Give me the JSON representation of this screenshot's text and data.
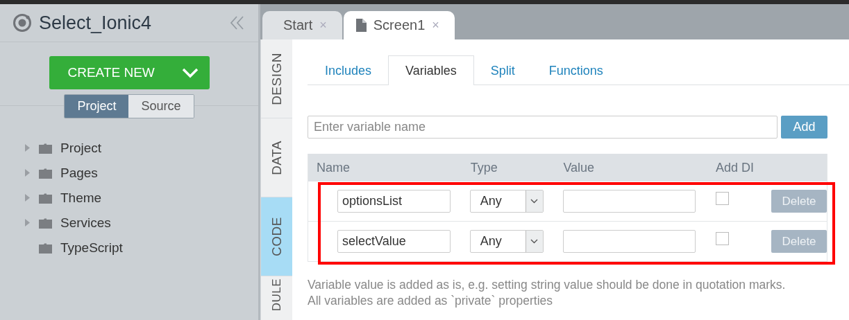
{
  "project": {
    "title": "Select_Ionic4"
  },
  "create_button": {
    "label": "CREATE NEW"
  },
  "view_toggle": [
    {
      "label": "Project",
      "selected": true
    },
    {
      "label": "Source",
      "selected": false
    }
  ],
  "tree": [
    {
      "label": "Project",
      "expandable": true
    },
    {
      "label": "Pages",
      "expandable": true
    },
    {
      "label": "Theme",
      "expandable": true
    },
    {
      "label": "Services",
      "expandable": true
    },
    {
      "label": "TypeScript",
      "expandable": false
    }
  ],
  "file_tabs": [
    {
      "label": "Start",
      "kind": "start",
      "selected": false,
      "close": "×"
    },
    {
      "label": "Screen1",
      "kind": "page",
      "selected": true,
      "close": "×"
    }
  ],
  "side_tabs": [
    {
      "label": "DESIGN",
      "selected": false
    },
    {
      "label": "DATA",
      "selected": false
    },
    {
      "label": "CODE",
      "selected": true
    },
    {
      "label": "DULE",
      "selected": false
    }
  ],
  "code_tabs": [
    {
      "label": "Includes",
      "selected": false
    },
    {
      "label": "Variables",
      "selected": true
    },
    {
      "label": "Split",
      "selected": false
    },
    {
      "label": "Functions",
      "selected": false
    }
  ],
  "variable_input": {
    "placeholder": "Enter variable name"
  },
  "add_button": {
    "label": "Add"
  },
  "table": {
    "columns": [
      "Name",
      "Type",
      "Value",
      "Add DI"
    ],
    "rows": [
      {
        "name": "optionsList",
        "type": "Any",
        "add_di": false,
        "delete": "Delete",
        "delete_disabled": true
      },
      {
        "name": "selectValue",
        "type": "Any",
        "add_di": false,
        "delete": "Delete",
        "delete_disabled": true
      }
    ]
  },
  "notes": [
    "Variable value is added as is, e.g. setting string value should be done in quotation marks.",
    "All variables are added as `private` properties"
  ]
}
